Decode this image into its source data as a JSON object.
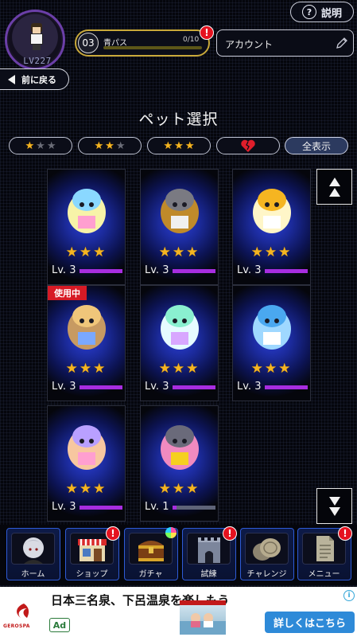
{
  "header": {
    "level_text": "LV227",
    "help_label": "説明",
    "pass": {
      "number": "03",
      "label": "青パス",
      "count_text": "0/10",
      "progress": 0.0,
      "badge": "!"
    },
    "account_label": "アカウント"
  },
  "nav": {
    "back_label": "前に戻る"
  },
  "page": {
    "title": "ペット選択"
  },
  "filters": [
    {
      "stars": 1,
      "active": false
    },
    {
      "stars": 2,
      "active": false
    },
    {
      "stars": 3,
      "active": false
    },
    {
      "icon": "broken-heart-icon",
      "active": false
    },
    {
      "label": "全表示",
      "active": true
    }
  ],
  "filter_glyphs": {
    "star": "★",
    "heart": "💔"
  },
  "pets": [
    {
      "name": "skull-pet",
      "stars": 3,
      "level_text": "Lv. 3",
      "progress": 1.0,
      "in_use": false
    },
    {
      "name": "box-head-pet",
      "stars": 3,
      "level_text": "Lv. 3",
      "progress": 1.0,
      "in_use": false
    },
    {
      "name": "cat-pet",
      "stars": 3,
      "level_text": "Lv. 3",
      "progress": 1.0,
      "in_use": false
    },
    {
      "name": "sheep-pet",
      "stars": 3,
      "level_text": "Lv. 3",
      "progress": 1.0,
      "in_use": true
    },
    {
      "name": "wings-pet",
      "stars": 3,
      "level_text": "Lv. 3",
      "progress": 1.0,
      "in_use": false
    },
    {
      "name": "narwhal-pet",
      "stars": 3,
      "level_text": "Lv. 3",
      "progress": 1.0,
      "in_use": false
    },
    {
      "name": "bear-pet",
      "stars": 3,
      "level_text": "Lv. 3",
      "progress": 1.0,
      "in_use": false
    },
    {
      "name": "bird-pet",
      "stars": 3,
      "level_text": "Lv. 1",
      "progress": 0.1,
      "in_use": false
    }
  ],
  "in_use_label": "使用中",
  "star_string": "★★★",
  "bottom_nav": [
    {
      "label": "ホーム",
      "icon": "avatar-icon",
      "badge": false
    },
    {
      "label": "ショップ",
      "icon": "shop-icon",
      "badge": true
    },
    {
      "label": "ガチャ",
      "icon": "treasure-chest-icon",
      "badge": false
    },
    {
      "label": "試練",
      "icon": "castle-icon",
      "badge": true
    },
    {
      "label": "チャレンジ",
      "icon": "coins-icon",
      "badge": false
    },
    {
      "label": "メニュー",
      "icon": "document-icon",
      "badge": true
    }
  ],
  "badge_text": "!",
  "ad": {
    "headline": "日本三名泉、下呂温泉を楽しもう",
    "tag": "Ad",
    "cta": "詳しくはこちら",
    "logo_text": "GEROSPA",
    "info": "i"
  },
  "colors": {
    "star": "#f5b521",
    "level_bar": "#a72de0",
    "badge": "#e5121f",
    "nav_border": "#2e5bd6",
    "card_glow": "#2b3fd8",
    "in_use": "#d71a25",
    "ad_cta": "#2e8ad8"
  }
}
